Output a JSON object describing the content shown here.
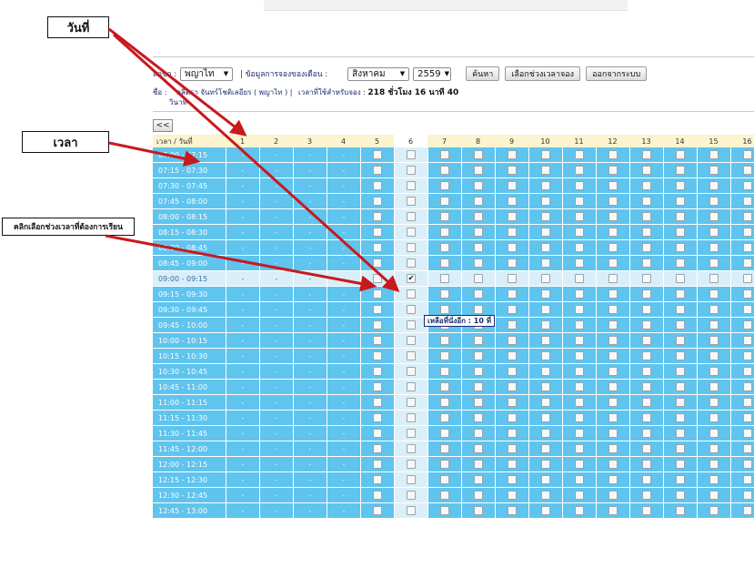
{
  "callouts": {
    "date": "วันที่",
    "time": "เวลา",
    "click": "คลิกเลือกช่วงเวลาที่ต้องการเรียน"
  },
  "form": {
    "branch_label": "สาขา :",
    "branch_value": "พญาไท",
    "booking_label": "| ข้อมูลการจองของเดือน :",
    "month_value": "สิงหาคม",
    "year_value": "2559",
    "search_button": "ค้นหา",
    "choose_button": "เลือกช่วงเวลาจอง",
    "logout_button": "ออกจากระบบ",
    "name_label": "ชื่อ :",
    "name_value": "ลลิตรา จันทร์โชติเลอียร ( พญาไท ) |",
    "remaining_label": "เวลาที่ใช้สำหรับจอง :",
    "remaining_value": "218 ชั่วโมง 16 นาที 40",
    "remaining_unit": "วินาที"
  },
  "back_button": "<<",
  "tooltip": "เหลือที่นั่งอีก : 10 ที่",
  "colors": {
    "row_blue": "#5fc4ee",
    "header_yellow": "#fbf4cf",
    "selected_row": "#d9eef8",
    "arrow_red": "#c8191e"
  },
  "chart_data": {
    "type": "table",
    "column_header": "เวลา / วันที่",
    "days": [
      "1",
      "2",
      "3",
      "4",
      "5",
      "6",
      "7",
      "8",
      "9",
      "10",
      "11",
      "12",
      "13",
      "14",
      "15",
      "16"
    ],
    "time_slots": [
      "07:00 - 07:15",
      "07:15 - 07:30",
      "07:30 - 07:45",
      "07:45 - 08:00",
      "08:00 - 08:15",
      "08:15 - 08:30",
      "08:30 - 08:45",
      "08:45 - 09:00",
      "09:00 - 09:15",
      "09:15 - 09:30",
      "09:30 - 09:45",
      "09:45 - 10:00",
      "10:00 - 10:15",
      "10:15 - 10:30",
      "10:30 - 10:45",
      "10:45 - 11:00",
      "11:00 - 11:15",
      "11:15 - 11:30",
      "11:30 - 11:45",
      "11:45 - 12:00",
      "12:00 - 12:15",
      "12:15 - 12:30",
      "12:30 - 12:45",
      "12:45 - 13:00"
    ],
    "unavailable_days": [
      "1",
      "2",
      "3",
      "4"
    ],
    "unavailable_mark": "-",
    "highlight_column": "6",
    "selected_slot": "09:00 - 09:15",
    "checked_cell": {
      "day": "6",
      "slot": "09:00 - 09:15"
    }
  }
}
